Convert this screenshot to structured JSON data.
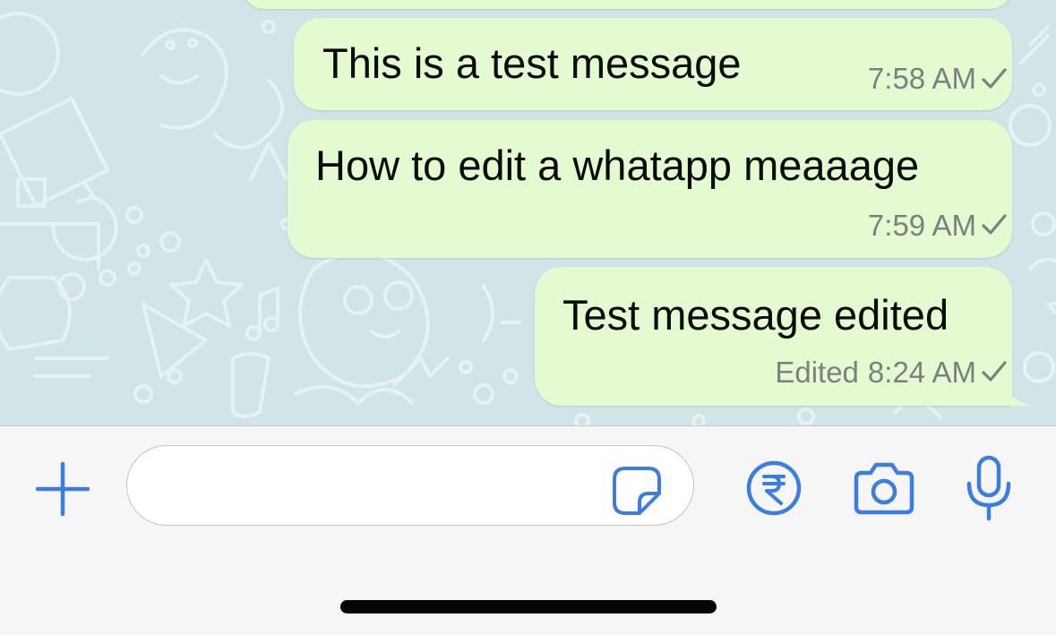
{
  "colors": {
    "chat_background": "#d1e5e9",
    "outgoing_bubble": "#e4fad0",
    "accent_blue": "#3b7de0",
    "meta_gray": "#7e7f7f"
  },
  "messages": [
    {
      "text": "This is a test message",
      "edited_label": "",
      "time": "7:58 AM",
      "status_icon": "single-check-icon"
    },
    {
      "text": "How to edit a whatapp meaaage",
      "edited_label": "",
      "time": "7:59 AM",
      "status_icon": "single-check-icon"
    },
    {
      "text": "Test message edited",
      "edited_label": "Edited",
      "time": "8:24 AM",
      "status_icon": "single-check-icon"
    }
  ],
  "composer": {
    "input_value": "",
    "icons": [
      "plus-icon",
      "sticker-icon",
      "rupee-payment-icon",
      "camera-icon",
      "microphone-icon"
    ]
  }
}
